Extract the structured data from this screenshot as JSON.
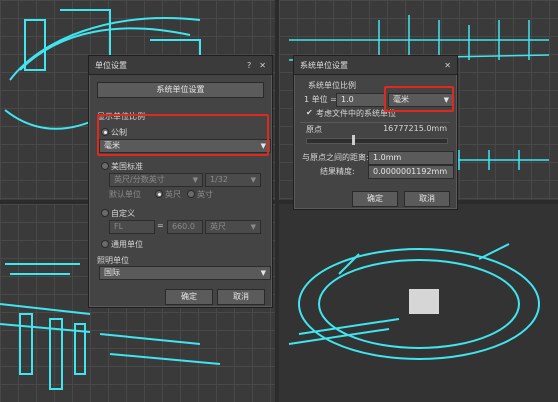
{
  "colors": {
    "highlight": "#e0281e",
    "model_cyan": "#3fe6f0",
    "viewport": "#3a3a3a"
  },
  "dialog_units": {
    "title": "单位设置",
    "help_icon": "question-icon",
    "close_icon": "close-icon",
    "system_button": "系统单位设置",
    "display_scale_label": "显示单位比例",
    "metric_label": "公制",
    "metric_value": "毫米",
    "us_standard_label": "美国标准",
    "us_unit_value": "英尺/分数英寸",
    "us_fraction_value": "1/32",
    "default_unit_label": "默认单位",
    "feet_label": "英尺",
    "inch_label": "英寸",
    "custom_label": "自定义",
    "custom_name_value": "FL",
    "equals_label": "=",
    "custom_amount_value": "660.0",
    "custom_unit_value": "英尺",
    "generic_label": "通用单位",
    "lighting_label": "照明单位",
    "lighting_value": "国际",
    "ok_label": "确定",
    "cancel_label": "取消"
  },
  "dialog_system": {
    "title": "系统单位设置",
    "close_icon": "close-icon",
    "scale_label": "系统单位比例",
    "unit_prefix": "1 单位 =",
    "unit_amount": "1.0",
    "unit_value": "毫米",
    "respect_label": "考虑文件中的系统单位",
    "origin_label": "原点",
    "origin_value": "16777215.0mm",
    "distance_label": "与原点之间的距离:",
    "distance_value": "1.0mm",
    "precision_label": "结果精度:",
    "precision_value": "0.0000001192mm",
    "ok_label": "确定",
    "cancel_label": "取消"
  }
}
